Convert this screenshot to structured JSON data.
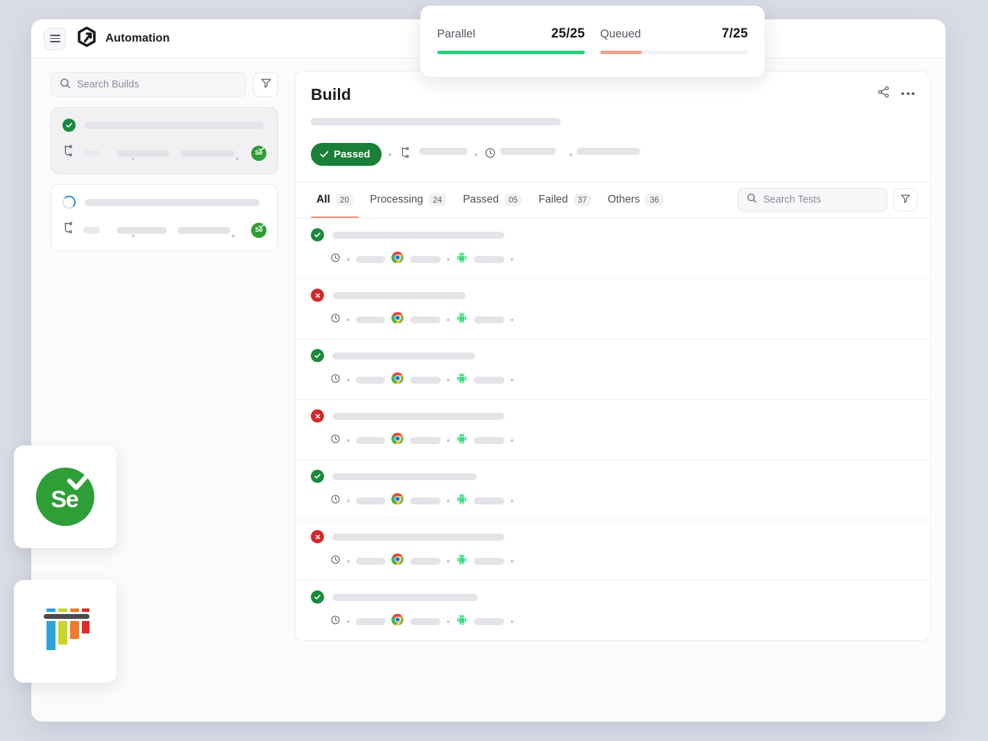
{
  "app": {
    "brand_name": "Automation",
    "menu_icon": "hamburger-menu-icon",
    "logo_icon": "lambdatest-hexagon-arrow-logo"
  },
  "stats": {
    "parallel": {
      "label": "Parallel",
      "value": "25/25",
      "used": 25,
      "total": 25,
      "percent": 100,
      "color": "#2ad17e"
    },
    "queued": {
      "label": "Queued",
      "value": "7/25",
      "used": 7,
      "total": 25,
      "percent": 28,
      "color": "#f1a18a"
    }
  },
  "sidebar": {
    "search": {
      "placeholder": "Search Builds",
      "icon": "search-icon"
    },
    "filter_icon": "filter-funnel-icon",
    "builds": [
      {
        "status": "passed",
        "status_icon": "check-circle-icon",
        "selected": true,
        "framework_badge": "selenium-badge",
        "branch_icon": "git-branch-icon"
      },
      {
        "status": "running",
        "status_icon": "loading-spinner-icon",
        "selected": false,
        "framework_badge": "selenium-badge",
        "branch_icon": "git-branch-icon"
      }
    ]
  },
  "detail": {
    "title": "Build",
    "share_icon": "share-nodes-icon",
    "more_icon": "more-options-icon",
    "status_badge": {
      "label": "Passed",
      "icon": "check-icon",
      "color": "#1a7f37"
    },
    "meta_icons": [
      "git-branch-icon",
      "clock-icon"
    ],
    "tabs": [
      {
        "label": "All",
        "count": "20",
        "active": true
      },
      {
        "label": "Processing",
        "count": "24",
        "active": false
      },
      {
        "label": "Passed",
        "count": "05",
        "active": false
      },
      {
        "label": "Failed",
        "count": "37",
        "active": false
      },
      {
        "label": "Others",
        "count": "36",
        "active": false
      }
    ],
    "active_tab_color": "#f08a70",
    "search": {
      "placeholder": "Search Tests",
      "icon": "search-icon"
    },
    "filter_icon": "filter-funnel-icon",
    "tests": [
      {
        "status": "passed",
        "status_icon": "check-circle-icon",
        "browser_icon": "chrome-icon",
        "os_icon": "android-icon"
      },
      {
        "status": "failed",
        "status_icon": "cross-circle-icon",
        "browser_icon": "chrome-icon",
        "os_icon": "android-icon"
      },
      {
        "status": "passed",
        "status_icon": "check-circle-icon",
        "browser_icon": "chrome-icon",
        "os_icon": "android-icon"
      },
      {
        "status": "failed",
        "status_icon": "cross-circle-icon",
        "browser_icon": "chrome-icon",
        "os_icon": "android-icon"
      },
      {
        "status": "passed",
        "status_icon": "check-circle-icon",
        "browser_icon": "chrome-icon",
        "os_icon": "android-icon"
      },
      {
        "status": "failed",
        "status_icon": "cross-circle-icon",
        "browser_icon": "chrome-icon",
        "os_icon": "android-icon"
      },
      {
        "status": "passed",
        "status_icon": "check-circle-icon",
        "browser_icon": "chrome-icon",
        "os_icon": "android-icon"
      }
    ]
  },
  "floating_logos": [
    {
      "name": "selenium-logo",
      "text": "Se",
      "color": "#2e9e36"
    },
    {
      "name": "testng-logo",
      "text": "",
      "color": "#4a4a4a"
    }
  ],
  "theme": {
    "page_background": "#d9dbe6",
    "panel_background": "#fbfbfc",
    "pass_green": "#178a3c",
    "fail_red": "#d3292b",
    "accent_coral": "#f08a70"
  }
}
